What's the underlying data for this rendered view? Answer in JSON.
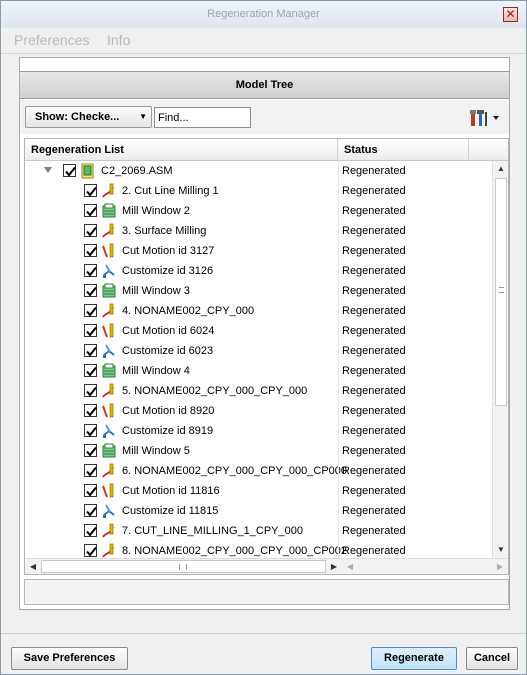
{
  "window": {
    "title": "Regeneration Manager",
    "close_symbol": "✕"
  },
  "menu": {
    "items": [
      "Preferences",
      "Info"
    ]
  },
  "panel": {
    "title": "Model Tree"
  },
  "toolbar": {
    "show_label": "Show: Checke...",
    "show_arrow": "▼",
    "find_placeholder": "Find...",
    "settings_icon": "settings-tools-icon"
  },
  "columns": {
    "name": "Regeneration List",
    "status": "Status"
  },
  "rows": [
    {
      "label": "C2_2069.ASM",
      "status": "Regenerated",
      "icon": "assembly-icon",
      "level": 0,
      "checked": true,
      "expanded": true
    },
    {
      "label": "2. Cut Line Milling 1",
      "status": "Regenerated",
      "icon": "nc-sequence-icon",
      "level": 1,
      "checked": true
    },
    {
      "label": "Mill Window 2",
      "status": "Regenerated",
      "icon": "mill-window-icon",
      "level": 1,
      "checked": true
    },
    {
      "label": "3. Surface Milling",
      "status": "Regenerated",
      "icon": "nc-sequence-icon",
      "level": 1,
      "checked": true
    },
    {
      "label": "Cut Motion id 3127",
      "status": "Regenerated",
      "icon": "cut-motion-icon",
      "level": 1,
      "checked": true
    },
    {
      "label": "Customize id 3126",
      "status": "Regenerated",
      "icon": "customize-icon",
      "level": 1,
      "checked": true
    },
    {
      "label": "Mill Window 3",
      "status": "Regenerated",
      "icon": "mill-window-icon",
      "level": 1,
      "checked": true
    },
    {
      "label": "4. NONAME002_CPY_000",
      "status": "Regenerated",
      "icon": "nc-sequence-icon",
      "level": 1,
      "checked": true
    },
    {
      "label": "Cut Motion id 6024",
      "status": "Regenerated",
      "icon": "cut-motion-icon",
      "level": 1,
      "checked": true
    },
    {
      "label": "Customize id 6023",
      "status": "Regenerated",
      "icon": "customize-icon",
      "level": 1,
      "checked": true
    },
    {
      "label": "Mill Window 4",
      "status": "Regenerated",
      "icon": "mill-window-icon",
      "level": 1,
      "checked": true
    },
    {
      "label": "5. NONAME002_CPY_000_CPY_000",
      "status": "Regenerated",
      "icon": "nc-sequence-icon",
      "level": 1,
      "checked": true
    },
    {
      "label": "Cut Motion id 8920",
      "status": "Regenerated",
      "icon": "cut-motion-icon",
      "level": 1,
      "checked": true
    },
    {
      "label": "Customize id 8919",
      "status": "Regenerated",
      "icon": "customize-icon",
      "level": 1,
      "checked": true
    },
    {
      "label": "Mill Window 5",
      "status": "Regenerated",
      "icon": "mill-window-icon",
      "level": 1,
      "checked": true
    },
    {
      "label": "6. NONAME002_CPY_000_CPY_000_CP000",
      "status": "Regenerated",
      "icon": "nc-sequence-icon",
      "level": 1,
      "checked": true
    },
    {
      "label": "Cut Motion id 11816",
      "status": "Regenerated",
      "icon": "cut-motion-icon",
      "level": 1,
      "checked": true
    },
    {
      "label": "Customize id 11815",
      "status": "Regenerated",
      "icon": "customize-icon",
      "level": 1,
      "checked": true
    },
    {
      "label": "7. CUT_LINE_MILLING_1_CPY_000",
      "status": "Regenerated",
      "icon": "nc-sequence-icon",
      "level": 1,
      "checked": true
    },
    {
      "label": "8. NONAME002_CPY_000_CPY_000_CP002",
      "status": "Regenerated",
      "icon": "nc-sequence-icon",
      "level": 1,
      "checked": true
    }
  ],
  "scroll": {
    "up": "▲",
    "down": "▼",
    "left": "◀",
    "right": "▶"
  },
  "buttons": {
    "save_preferences": "Save Preferences",
    "regenerate": "Regenerate",
    "cancel": "Cancel"
  }
}
